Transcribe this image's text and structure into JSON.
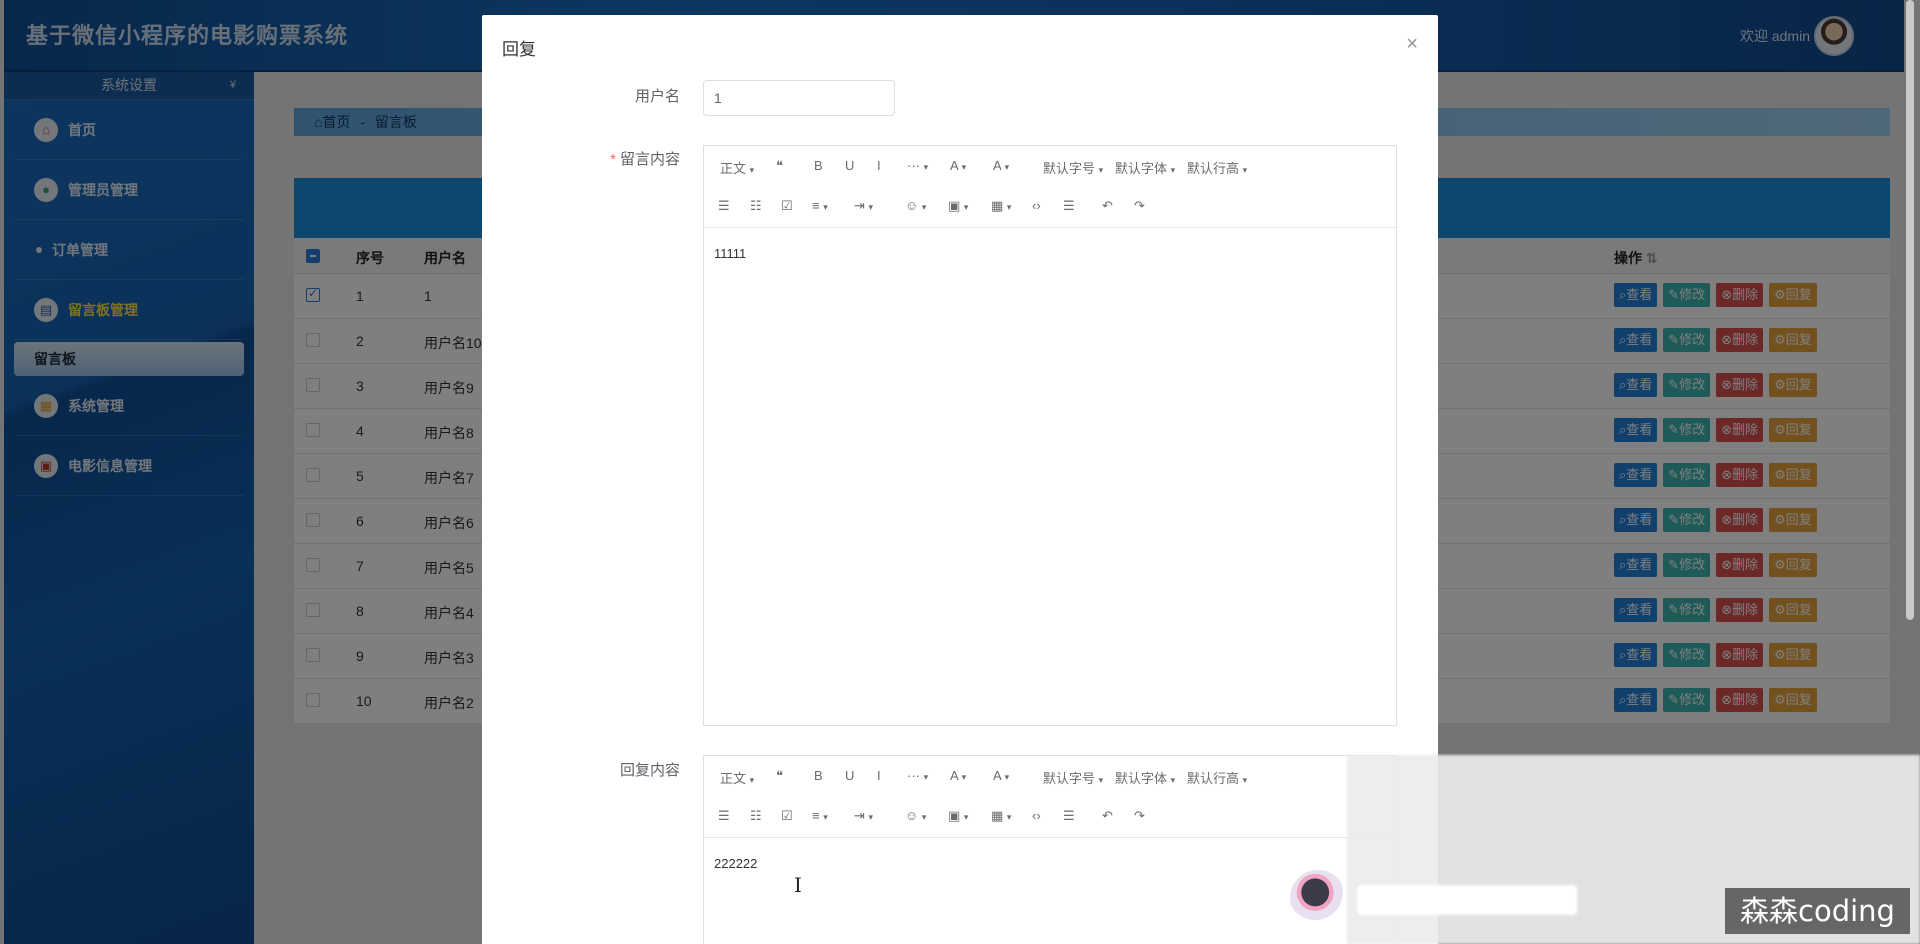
{
  "app_title": "基于微信小程序的电影购票系统",
  "header": {
    "welcome": "欢迎 admin"
  },
  "sidebar": {
    "heading": "系统设置",
    "heading_chevron": "¥",
    "items": [
      {
        "label": "首页",
        "icon": "home-icon"
      },
      {
        "label": "管理员管理",
        "icon": "user-icon"
      },
      {
        "label": "订单管理",
        "icon": "dot-icon"
      },
      {
        "label": "留言板管理",
        "icon": "board-icon"
      },
      {
        "label": "系统管理",
        "icon": "system-icon"
      },
      {
        "label": "电影信息管理",
        "icon": "movie-icon"
      }
    ],
    "active_sub": "留言板"
  },
  "breadcrumb": {
    "home": "首页",
    "separator": "-",
    "current": "留言板"
  },
  "table": {
    "headers": {
      "no": "序号",
      "username": "用户名",
      "actions": "操作"
    },
    "actions": {
      "view": "查看",
      "edit": "修改",
      "delete": "删除",
      "reply": "回复"
    },
    "rows": [
      {
        "no": "1",
        "username": "1",
        "checked": true
      },
      {
        "no": "2",
        "username": "用户名10",
        "checked": false
      },
      {
        "no": "3",
        "username": "用户名9",
        "checked": false
      },
      {
        "no": "4",
        "username": "用户名8",
        "checked": false
      },
      {
        "no": "5",
        "username": "用户名7",
        "checked": false
      },
      {
        "no": "6",
        "username": "用户名6",
        "checked": false
      },
      {
        "no": "7",
        "username": "用户名5",
        "checked": false
      },
      {
        "no": "8",
        "username": "用户名4",
        "checked": false
      },
      {
        "no": "9",
        "username": "用户名3",
        "checked": false
      },
      {
        "no": "10",
        "username": "用户名2",
        "checked": false
      }
    ]
  },
  "dialog": {
    "title": "回复",
    "close_icon": "×",
    "username_label": "用户名",
    "username_value": "1",
    "message_label": "留言内容",
    "required_mark": "*",
    "message_content": "11111",
    "reply_label": "回复内容",
    "reply_content": "222222"
  },
  "editor_toolbar": {
    "heading": "正文",
    "quote": "❝",
    "bold": "B",
    "underline": "U",
    "italic": "I",
    "more": "···",
    "font_color": "A",
    "bg_color": "A",
    "font_size": "默认字号",
    "font_family": "默认字体",
    "line_height": "默认行高",
    "bullet_list": "☰",
    "numbered_list": "☷",
    "todo": "☑",
    "align": "≡",
    "indent": "⇥",
    "emoji": "☺",
    "image": "▣",
    "table": "▦",
    "code": "‹›",
    "divider": "☰",
    "undo": "↶",
    "redo": "↷"
  },
  "watermark": "森森coding"
}
